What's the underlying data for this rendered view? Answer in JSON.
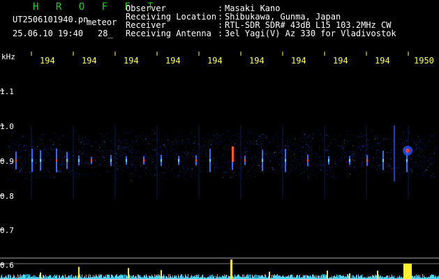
{
  "header": {
    "brand": "H R O F F T",
    "filename": "UT2506101940.pn",
    "tag": "meteor",
    "date": "25.06.10 19:40",
    "count": "28_",
    "fields": [
      {
        "key": "Observer",
        "value": "Masaki Kano"
      },
      {
        "key": "Receiving Location",
        "value": "Shibukawa, Gunma, Japan"
      },
      {
        "key": "Receiver",
        "value": "RTL-SDR SDR# 43dB L15 103.2MHz CW"
      },
      {
        "key": "Receiving Antenna",
        "value": "3el Yagi(V) Az 330 for Vladivostok"
      }
    ]
  },
  "axes": {
    "unit": "kHz",
    "x_ticks": [
      "194",
      "194",
      "194",
      "194",
      "194",
      "194",
      "194",
      "194",
      "194",
      "1950"
    ],
    "y_ticks": [
      "1.1",
      "1.0",
      "0.9",
      "0.8",
      "0.7",
      "0.6"
    ]
  },
  "colors": {
    "header_text": "#ffffff",
    "brand": "#22d022",
    "tick": "#ffff55",
    "background": "#000000"
  }
}
